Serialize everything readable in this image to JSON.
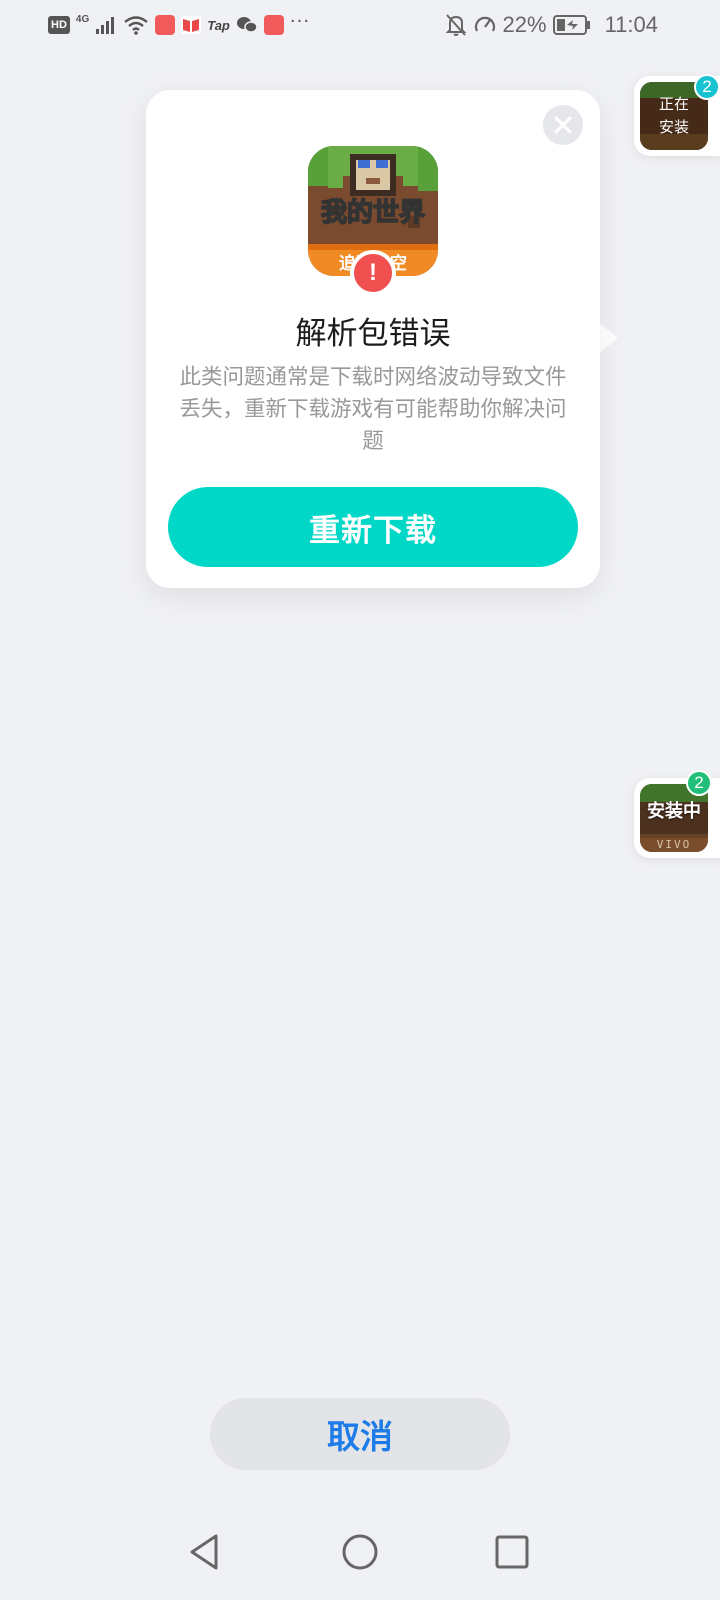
{
  "status_bar": {
    "hd": "HD",
    "network": "4G",
    "tap_label": "Tap",
    "more": "···",
    "battery": "22%",
    "time": "11:04"
  },
  "dialog": {
    "game_icon_title": "我的世界",
    "game_icon_subtitle": "追逐天空",
    "error_mark": "!",
    "title": "解析包错误",
    "description": "此类问题通常是下载时网络波动导致文件丢失，重新下载游戏有可能帮助你解决问题",
    "redownload_label": "重新下载"
  },
  "float_installing": {
    "label_line1": "正在",
    "label_line2": "安装",
    "count": "2",
    "badge_color": "#17c3d0"
  },
  "float_vivo": {
    "label": "安装中",
    "brand": "VIVO",
    "count": "2",
    "badge_color": "#21c07a"
  },
  "cancel_label": "取消",
  "icons": {
    "close": "close-icon",
    "back": "back-triangle-icon",
    "home": "home-circle-icon",
    "recents": "recents-square-icon"
  },
  "colors": {
    "accent": "#00d7c6",
    "cancel_text": "#1e7ce8",
    "error": "#f0504f"
  }
}
